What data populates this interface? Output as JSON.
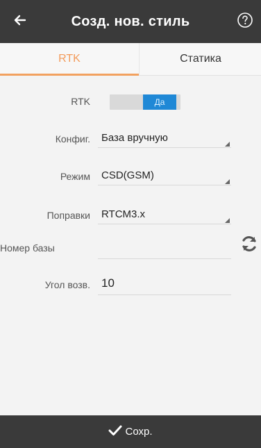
{
  "header": {
    "title": "Созд. нов. стиль",
    "back_icon": "arrow-left-icon",
    "help_icon": "question-circle-icon"
  },
  "tabs": [
    {
      "label": "RTK",
      "active": true
    },
    {
      "label": "Статика",
      "active": false
    }
  ],
  "form": {
    "rtk": {
      "label": "RTK",
      "toggle_text": "Да"
    },
    "config": {
      "label": "Конфиг.",
      "value": "База вручную"
    },
    "mode": {
      "label": "Режим",
      "value": "CSD(GSM)"
    },
    "corrections": {
      "label": "Поправки",
      "value": "RTCM3.x"
    },
    "base_number": {
      "label": "Номер базы",
      "value": ""
    },
    "elevation": {
      "label": "Угол возв.",
      "value": "10"
    }
  },
  "footer": {
    "save_label": "Сохр.",
    "save_icon": "checkmark-icon"
  },
  "colors": {
    "topbar": "#3a3a3a",
    "accent_orange": "#f2a15f",
    "toggle_blue": "#1f88d6",
    "background": "#f3f3f3"
  }
}
